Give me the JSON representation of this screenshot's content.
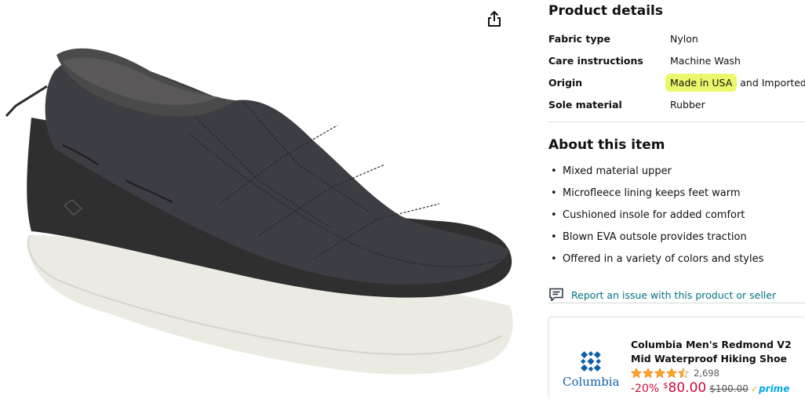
{
  "share": {
    "icon": "share-icon"
  },
  "product_details": {
    "title": "Product details",
    "rows": [
      {
        "label": "Fabric type",
        "value": "Nylon"
      },
      {
        "label": "Care instructions",
        "value": "Machine Wash"
      },
      {
        "label": "Origin",
        "value_highlight": "Made in USA",
        "value_rest": " and Imported"
      },
      {
        "label": "Sole material",
        "value": "Rubber"
      }
    ]
  },
  "about": {
    "title": "About this item",
    "bullets": [
      "Mixed material upper",
      "Microfleece lining keeps feet warm",
      "Cushioned insole for added comfort",
      "Blown EVA outsole provides traction",
      "Offered in a variety of colors and styles"
    ]
  },
  "report": {
    "label": "Report an issue with this product or seller",
    "icon": "feedback-icon"
  },
  "sponsored": {
    "brand": "Columbia",
    "title": "Columbia Men's Redmond V2 Mid Waterproof Hiking Shoe",
    "rating": 4.5,
    "rating_count": "2,698",
    "discount": "-20%",
    "currency": "$",
    "price": "80.00",
    "list_price": "$100.00",
    "prime": "prime"
  },
  "colors": {
    "link": "#007185",
    "highlight": "#ecf86b",
    "deal_red": "#cc0c39",
    "star": "#ffa41c",
    "brand_blue": "#0d5fa8"
  }
}
